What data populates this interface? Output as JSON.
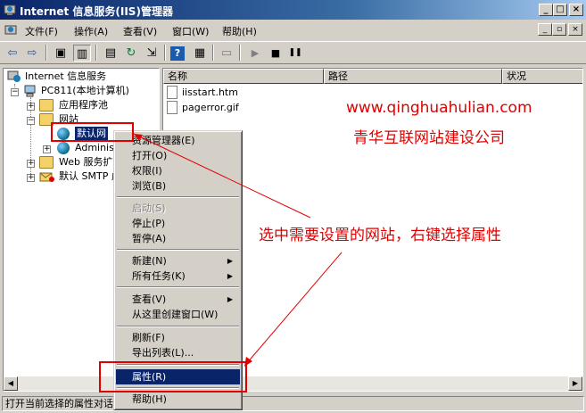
{
  "window": {
    "title": "Internet 信息服务(IIS)管理器",
    "controls": {
      "minimize": "_",
      "maximize": "□",
      "close": "×"
    }
  },
  "menubar": {
    "items": [
      "文件(F)",
      "操作(A)",
      "查看(V)",
      "窗口(W)",
      "帮助(H)"
    ],
    "mdi_controls": {
      "minimize": "_",
      "restore": "▫",
      "close": "×"
    }
  },
  "toolbar": {
    "icons": [
      "back-icon",
      "forward-icon",
      "up-icon",
      "show-tree-icon",
      "properties-icon",
      "refresh-icon",
      "export-icon",
      "help-icon",
      "view-icon",
      "computer-icon",
      "play-icon",
      "stop-icon",
      "pause-icon"
    ],
    "glyphs": {
      "back": "⇦",
      "forward": "⇨",
      "up": "▣",
      "tree": "▥",
      "properties": "▤",
      "refresh": "↻",
      "export": "⇲",
      "help": "?",
      "view": "▦",
      "computer": "▭",
      "play": "▶",
      "stop": "■",
      "pause": "❚❚"
    }
  },
  "tree": {
    "root": "Internet 信息服务",
    "computer": "PC811(本地计算机)",
    "app_pools": "应用程序池",
    "websites": "网站",
    "default_site": "默认网",
    "admin_site": "Administ",
    "web_ext": "Web 服务扩",
    "smtp": "默认 SMTP 虚",
    "expander_plus": "+",
    "expander_minus": "−"
  },
  "list": {
    "columns": [
      "名称",
      "路径",
      "状况"
    ],
    "rows": [
      {
        "name": "iisstart.htm"
      },
      {
        "name": "pagerror.gif"
      }
    ]
  },
  "watermark": {
    "url": "www.qinghuahulian.com",
    "company": "青华互联网站建设公司"
  },
  "annotation": {
    "text": "选中需要设置的网站，右键选择属性",
    "color": "#e00000"
  },
  "context_menu": {
    "items": [
      {
        "label": "资源管理器(E)",
        "disabled": false
      },
      {
        "label": "打开(O)",
        "disabled": false
      },
      {
        "label": "权限(I)",
        "disabled": false
      },
      {
        "label": "浏览(B)",
        "disabled": false
      },
      {
        "separator": true
      },
      {
        "label": "启动(S)",
        "disabled": true
      },
      {
        "label": "停止(P)",
        "disabled": false
      },
      {
        "label": "暂停(A)",
        "disabled": false
      },
      {
        "separator": true
      },
      {
        "label": "新建(N)",
        "submenu": true
      },
      {
        "label": "所有任务(K)",
        "submenu": true
      },
      {
        "separator": true
      },
      {
        "label": "查看(V)",
        "submenu": true
      },
      {
        "label": "从这里创建窗口(W)",
        "disabled": false
      },
      {
        "separator": true
      },
      {
        "label": "刷新(F)",
        "disabled": false
      },
      {
        "label": "导出列表(L)...",
        "disabled": false
      },
      {
        "separator": true
      },
      {
        "label": "属性(R)",
        "selected": true
      },
      {
        "separator": true
      },
      {
        "label": "帮助(H)",
        "disabled": false
      }
    ],
    "submenu_arrow": "▶"
  },
  "statusbar": {
    "text": "打开当前选择的属性对话框。"
  },
  "scrollbar": {
    "left": "◀",
    "right": "▶"
  }
}
